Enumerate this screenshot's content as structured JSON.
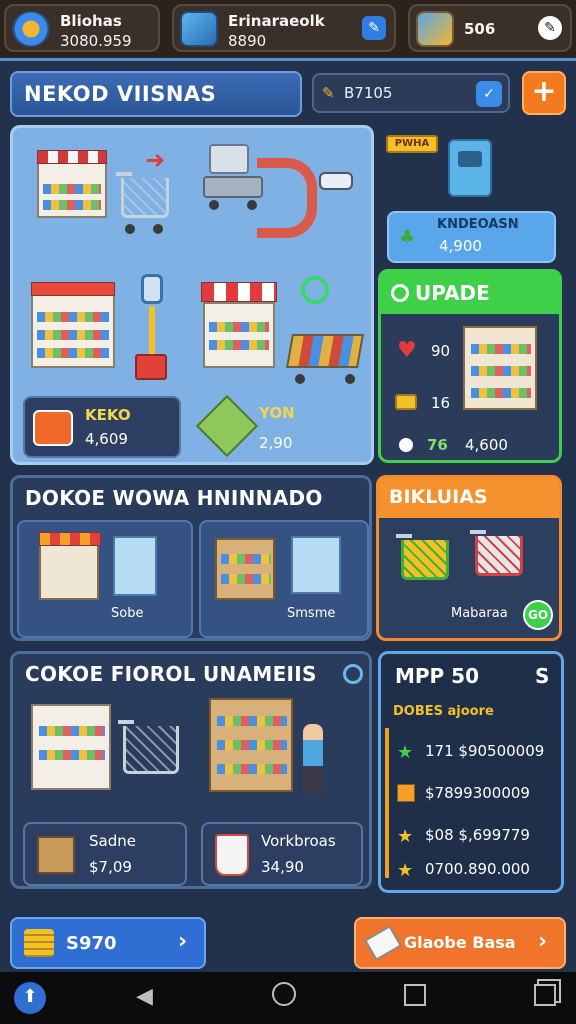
{
  "top_stats": [
    {
      "title": "Bliohas",
      "value": "3080.959"
    },
    {
      "title": "Erinaraeolk",
      "value": "8890"
    },
    {
      "title": "506",
      "value": ""
    }
  ],
  "header": {
    "title": "NEKOD VIISNAS",
    "dropdown_value": "B7105"
  },
  "store": {
    "tag": "PWHA",
    "chip1": {
      "label": "KEKO",
      "value": "4,609"
    },
    "chip2": {
      "label": "YON",
      "value": "2,90"
    }
  },
  "side": {
    "card_label": "KNDEOASN",
    "card_value": "4,900"
  },
  "upgrade": {
    "title": "UPADE",
    "rows": [
      {
        "value": "90"
      },
      {
        "value": "16"
      },
      {
        "value": "76",
        "extra": "4,600"
      }
    ]
  },
  "section2": {
    "title": "DOKOE WOWA HNINNADO",
    "cards": [
      {
        "label": "Sobe"
      },
      {
        "label": "Smsme"
      }
    ]
  },
  "section2_right": {
    "title": "BIKLUIAS",
    "label": "Mabaraa",
    "badge": "GO"
  },
  "section3": {
    "title": "COKOE FIOROL UNAMEIIS",
    "chips": [
      {
        "label": "Sadne",
        "value": "$7,09"
      },
      {
        "label": "Vorkbroas",
        "value": "34,90"
      }
    ]
  },
  "section3_right": {
    "title": "MPP 50",
    "action": "S",
    "subtitle": "DOBES ajoore",
    "rows": [
      {
        "value": "171 $90500009"
      },
      {
        "value": "$7899300009"
      },
      {
        "value": "$08 $,699779"
      },
      {
        "value": "0700.890.000"
      }
    ]
  },
  "bottom": {
    "left_value": "S970",
    "right_label": "Glaobe Basa"
  },
  "colors": {
    "accent_green": "#3fd04a",
    "accent_orange": "#f5922e",
    "accent_blue": "#2f6ed3"
  }
}
